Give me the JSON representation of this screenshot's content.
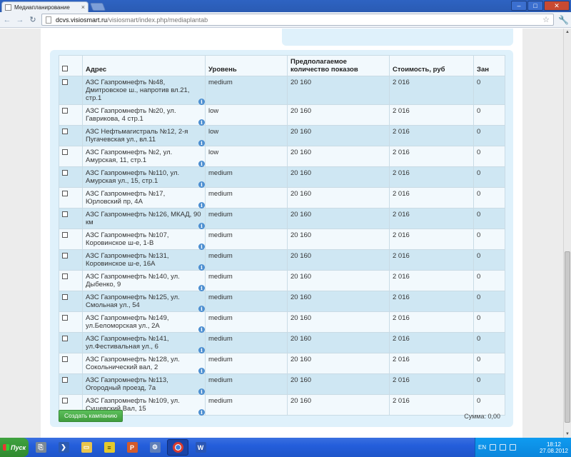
{
  "browser": {
    "tab_title": "Медиапланирование",
    "tab_close": "×",
    "url_host": "dcvs.visiosmart.ru",
    "url_path": "/visiosmart/index.php/mediaplantab",
    "back": "←",
    "forward": "→",
    "reload": "↻",
    "star": "☆",
    "wrench": "🔧",
    "min": "–",
    "max": "□",
    "close": "✕"
  },
  "table": {
    "headers": {
      "address": "Адрес",
      "level": "Уровень",
      "shows": "Предполагаемое количество показов",
      "cost": "Стоимость, руб",
      "busy": "Зан"
    },
    "rows": [
      {
        "address": "АЗС Газпромнефть №48, Дмитровское ш., напротив вл.21, стр.1",
        "level": "medium",
        "shows": "20 160",
        "cost": "2 016",
        "busy": "0"
      },
      {
        "address": "АЗС Газпромнефть №20, ул. Гаврикова, 4 стр.1",
        "level": "low",
        "shows": "20 160",
        "cost": "2 016",
        "busy": "0"
      },
      {
        "address": "АЗС Нефтьмагистраль №12, 2-я Пугачевская ул., вл.11",
        "level": "low",
        "shows": "20 160",
        "cost": "2 016",
        "busy": "0"
      },
      {
        "address": "АЗС Газпромнефть №2, ул. Амурская, 11, стр.1",
        "level": "low",
        "shows": "20 160",
        "cost": "2 016",
        "busy": "0"
      },
      {
        "address": "АЗС Газпромнефть №110, ул. Амурская ул., 15, стр.1",
        "level": "medium",
        "shows": "20 160",
        "cost": "2 016",
        "busy": "0"
      },
      {
        "address": "АЗС Газпромнефть №17, Юрловский пр, 4А",
        "level": "medium",
        "shows": "20 160",
        "cost": "2 016",
        "busy": "0"
      },
      {
        "address": "АЗС Газпромнефть №126, МКАД, 90 км",
        "level": "medium",
        "shows": "20 160",
        "cost": "2 016",
        "busy": "0"
      },
      {
        "address": "АЗС Газпромнефть №107, Коровинское ш-е, 1-В",
        "level": "medium",
        "shows": "20 160",
        "cost": "2 016",
        "busy": "0"
      },
      {
        "address": "АЗС Газпромнефть №131, Коровинское ш-е, 16А",
        "level": "medium",
        "shows": "20 160",
        "cost": "2 016",
        "busy": "0"
      },
      {
        "address": "АЗС Газпромнефть №140, ул. Дыбенко, 9",
        "level": "medium",
        "shows": "20 160",
        "cost": "2 016",
        "busy": "0"
      },
      {
        "address": "АЗС Газпромнефть №125, ул. Смольная ул., 54",
        "level": "medium",
        "shows": "20 160",
        "cost": "2 016",
        "busy": "0"
      },
      {
        "address": "АЗС Газпромнефть №149, ул.Беломорская ул., 2А",
        "level": "medium",
        "shows": "20 160",
        "cost": "2 016",
        "busy": "0"
      },
      {
        "address": "АЗС Газпромнефть №141, ул.Фестивальная ул., 6",
        "level": "medium",
        "shows": "20 160",
        "cost": "2 016",
        "busy": "0"
      },
      {
        "address": "АЗС Газпромнефть №128, ул. Сокольнический вал, 2",
        "level": "medium",
        "shows": "20 160",
        "cost": "2 016",
        "busy": "0"
      },
      {
        "address": "АЗС Газпромнефть №113, Огородный проезд, 7а",
        "level": "medium",
        "shows": "20 160",
        "cost": "2 016",
        "busy": "0"
      },
      {
        "address": "АЗС Газпромнефть №109, ул. Сущевский Вал, 15",
        "level": "medium",
        "shows": "20 160",
        "cost": "2 016",
        "busy": "0"
      }
    ],
    "info_icon": "i"
  },
  "footer": {
    "create_button": "Создать кампанию",
    "sum_label": "Сумма: 0,00"
  },
  "taskbar": {
    "start_label": "Пуск",
    "lang": "EN",
    "time": "18:12",
    "date": "27.08.2012"
  },
  "colors": {
    "panel_bg": "#dff1fb",
    "row_alt": "#cfe7f3",
    "button_green": "#4caf4b",
    "info_blue": "#4d8fd1"
  }
}
